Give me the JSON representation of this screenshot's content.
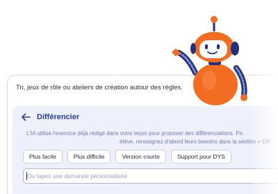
{
  "intro": {
    "text": "Tri, jeux de rôle ou ateliers de création autour des règles."
  },
  "panel": {
    "title": "Différencier",
    "description_line1": "L'IA utilise l'exercice déjà rédigé dans votre leçon pour proposer des différenciations. Po",
    "description_line2": "élève, renseignez d'abord leurs besoins dans la section « Diff"
  },
  "chips": [
    "Plus facile",
    "Plus difficile",
    "Version courte",
    "Support pour DYS"
  ],
  "input": {
    "placeholder": "Ou tapez une demande personnalisée",
    "value": ""
  },
  "icons": {
    "back": "arrow-left-icon",
    "mascot": "robot-mascot"
  },
  "colors": {
    "accent": "#2c3a9c",
    "panel_bg": "#eef1fb",
    "robot_orange": "#f26d21",
    "robot_navy": "#23307a"
  }
}
